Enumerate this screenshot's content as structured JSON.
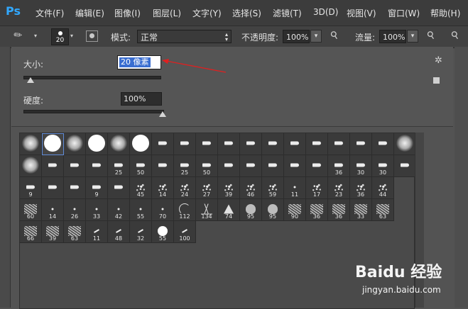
{
  "app": {
    "logo": "Ps"
  },
  "menu": [
    "文件(F)",
    "编辑(E)",
    "图像(I)",
    "图层(L)",
    "文字(Y)",
    "选择(S)",
    "滤镜(T)",
    "3D(D)",
    "视图(V)",
    "窗口(W)",
    "帮助(H)"
  ],
  "options": {
    "brush_size": "20",
    "mode_label": "模式:",
    "mode_value": "正常",
    "opacity_label": "不透明度:",
    "opacity_value": "100%",
    "flow_label": "流量:",
    "flow_value": "100%"
  },
  "brush_panel": {
    "size_label": "大小:",
    "size_value": "20 像素",
    "size_slider_fraction": 0.05,
    "hardness_label": "硬度:",
    "hardness_value": "100%",
    "hardness_slider_fraction": 1.0,
    "accent_color": "#3a6ed1",
    "annotation_arrow_color": "#e02020",
    "rows": [
      [
        [
          "soft",
          ""
        ],
        [
          "hard",
          ""
        ],
        [
          "soft",
          ""
        ],
        [
          "hard",
          ""
        ],
        [
          "soft",
          ""
        ],
        [
          "hard",
          ""
        ],
        [
          "tip",
          ""
        ],
        [
          "tip",
          ""
        ],
        [
          "tip",
          ""
        ],
        [
          "tip",
          ""
        ],
        [
          "tip",
          ""
        ],
        [
          "tip",
          ""
        ],
        [
          "tip",
          ""
        ],
        [
          "tip",
          ""
        ],
        [
          "tip",
          ""
        ],
        [
          "tip",
          ""
        ],
        [
          "tip",
          ""
        ],
        [
          "soft",
          ""
        ]
      ],
      [
        [
          "soft",
          ""
        ],
        [
          "tip",
          ""
        ],
        [
          "tip",
          ""
        ],
        [
          "tip",
          ""
        ],
        [
          "tip",
          "25"
        ],
        [
          "tip",
          "50"
        ],
        [
          "tip",
          ""
        ],
        [
          "tip",
          "25"
        ],
        [
          "tip",
          "50"
        ],
        [
          "tip",
          ""
        ],
        [
          "tip",
          ""
        ],
        [
          "tip",
          ""
        ],
        [
          "tip",
          ""
        ],
        [
          "tip",
          ""
        ],
        [
          "tip",
          "36"
        ],
        [
          "tip",
          "30"
        ],
        [
          "tip",
          "30"
        ],
        [
          "tip",
          ""
        ]
      ],
      [
        [
          "tip",
          "9"
        ],
        [
          "tip",
          ""
        ],
        [
          "tip",
          ""
        ],
        [
          "tip",
          "9"
        ],
        [
          "tip",
          ""
        ],
        [
          "spray",
          "45"
        ],
        [
          "spray",
          "14"
        ],
        [
          "spray",
          "24"
        ],
        [
          "spray",
          "27"
        ],
        [
          "spray",
          "39"
        ],
        [
          "spray",
          "46"
        ],
        [
          "spray",
          "59"
        ],
        [
          "dot",
          "11"
        ],
        [
          "spray",
          "17"
        ],
        [
          "spray",
          "23"
        ],
        [
          "spray",
          "36"
        ],
        [
          "spray",
          "44"
        ]
      ],
      [
        [
          "tex",
          "60"
        ],
        [
          "dot",
          "14"
        ],
        [
          "dot",
          "26"
        ],
        [
          "dot",
          "33"
        ],
        [
          "dot",
          "42"
        ],
        [
          "dot",
          "55"
        ],
        [
          "dot",
          "70"
        ],
        [
          "arc",
          "112"
        ],
        [
          "grass",
          "134"
        ],
        [
          "leaf",
          "74"
        ],
        [
          "blob",
          "95"
        ],
        [
          "blob",
          "95"
        ],
        [
          "tex",
          "90"
        ],
        [
          "tex",
          "36"
        ],
        [
          "tex",
          "36"
        ],
        [
          "tex",
          "33"
        ],
        [
          "tex",
          "63"
        ]
      ],
      [
        [
          "tex",
          "66"
        ],
        [
          "tex",
          "39"
        ],
        [
          "tex",
          "63"
        ],
        [
          "dash",
          "11"
        ],
        [
          "dash",
          "48"
        ],
        [
          "dash",
          "32"
        ],
        [
          "hardsmall",
          "55"
        ],
        [
          "dash",
          "100"
        ]
      ]
    ]
  },
  "watermark": {
    "main": "Baidu 经验",
    "sub": "jingyan.baidu.com"
  }
}
